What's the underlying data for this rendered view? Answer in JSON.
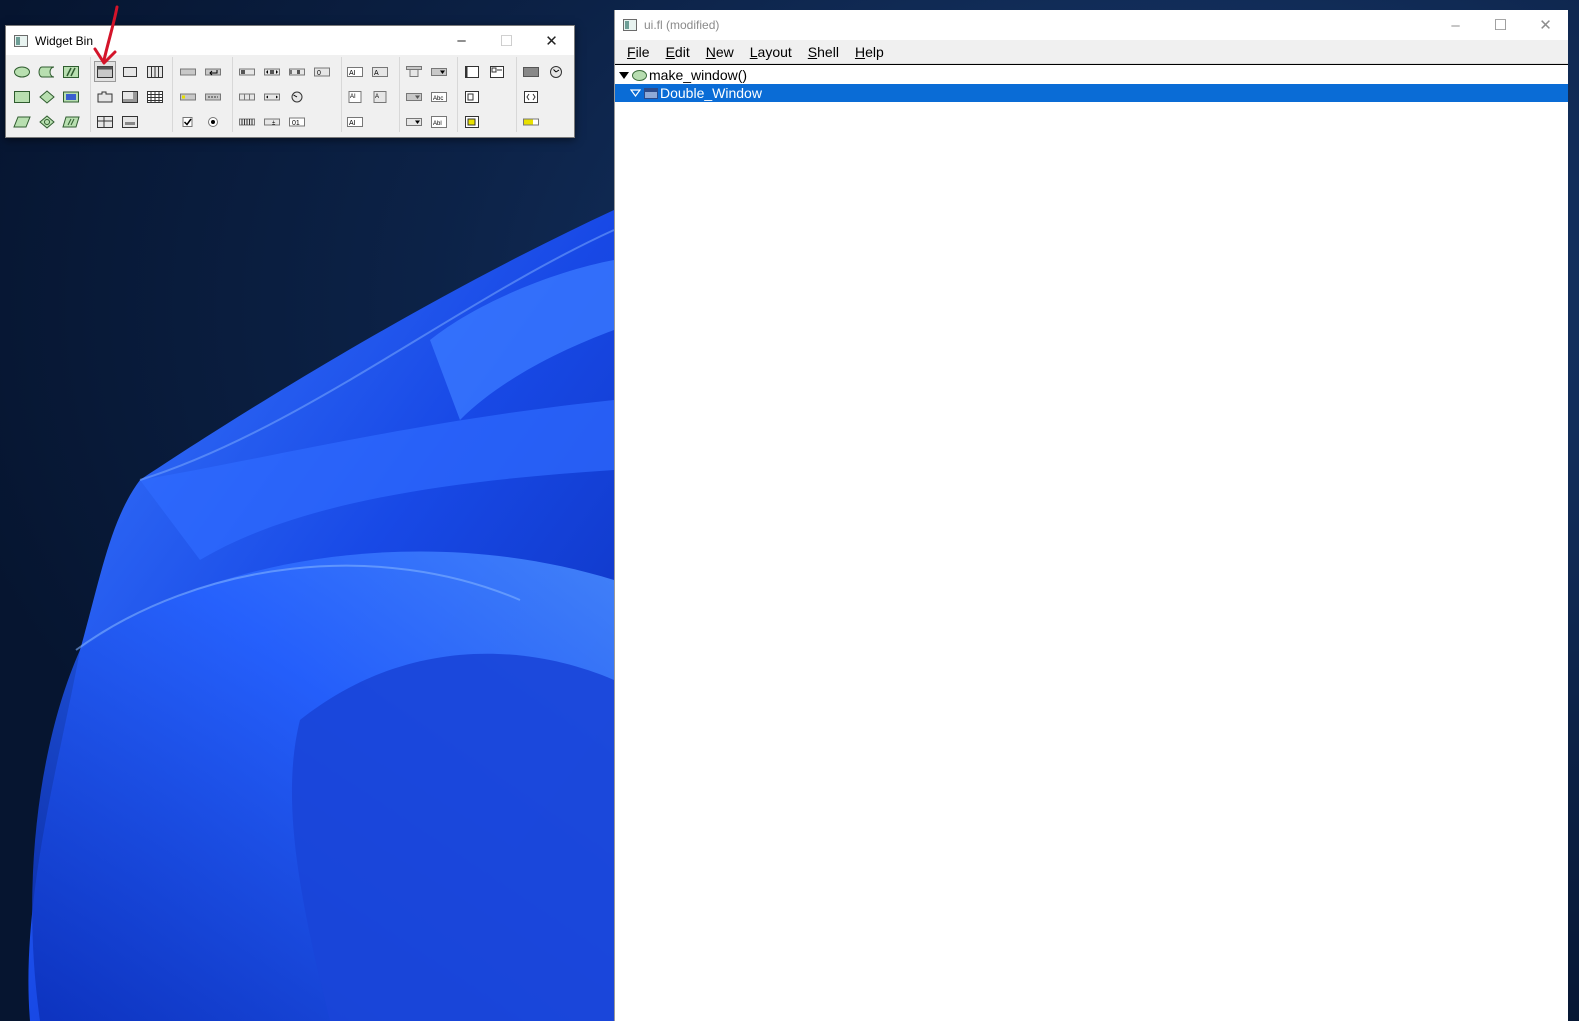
{
  "widget_bin": {
    "title": "Widget Bin",
    "controls": {
      "minimize": "–",
      "maximize": "☐",
      "close": "✕"
    }
  },
  "main_window": {
    "title": "ui.fl (modified)",
    "controls": {
      "minimize": "–",
      "maximize": "☐",
      "close": "✕"
    },
    "menu": [
      {
        "label": "File",
        "mnemonic": "F",
        "rest": "ile"
      },
      {
        "label": "Edit",
        "mnemonic": "E",
        "rest": "dit"
      },
      {
        "label": "New",
        "mnemonic": "N",
        "rest": "ew"
      },
      {
        "label": "Layout",
        "mnemonic": "L",
        "rest": "ayout"
      },
      {
        "label": "Shell",
        "mnemonic": "S",
        "rest": "hell"
      },
      {
        "label": "Help",
        "mnemonic": "H",
        "rest": "elp"
      }
    ],
    "tree": [
      {
        "label": "make_window()",
        "type": "function",
        "expanded": true,
        "selected": false
      },
      {
        "label": "Double_Window",
        "type": "window",
        "expanded": true,
        "selected": true
      }
    ]
  },
  "colors": {
    "selection": "#0a6cd6",
    "annotation_arrow": "#d4142a",
    "wallpaper_bg": "#0a1d3c",
    "wallpaper_bloom": "#1f5cf5"
  },
  "icons": [
    "function-tool-icon",
    "comment-tool-icon",
    "code-tool-icon",
    "window-tool-icon",
    "group-tool-icon",
    "pack-tool-icon",
    "declaration-tool-icon",
    "decl-block-tool-icon",
    "widget-class-tool-icon",
    "tabs-tool-icon",
    "scroll-tool-icon",
    "table-tool-icon",
    "data-tool-icon",
    "class-tool-icon",
    "code-block-tool-icon",
    "tile-tool-icon",
    "wizard-tool-icon",
    "button-tool-icon",
    "return-button-tool-icon",
    "light-button-tool-icon",
    "check-button-tool-icon",
    "round-button-tool-icon",
    "repeat-button-tool-icon"
  ]
}
